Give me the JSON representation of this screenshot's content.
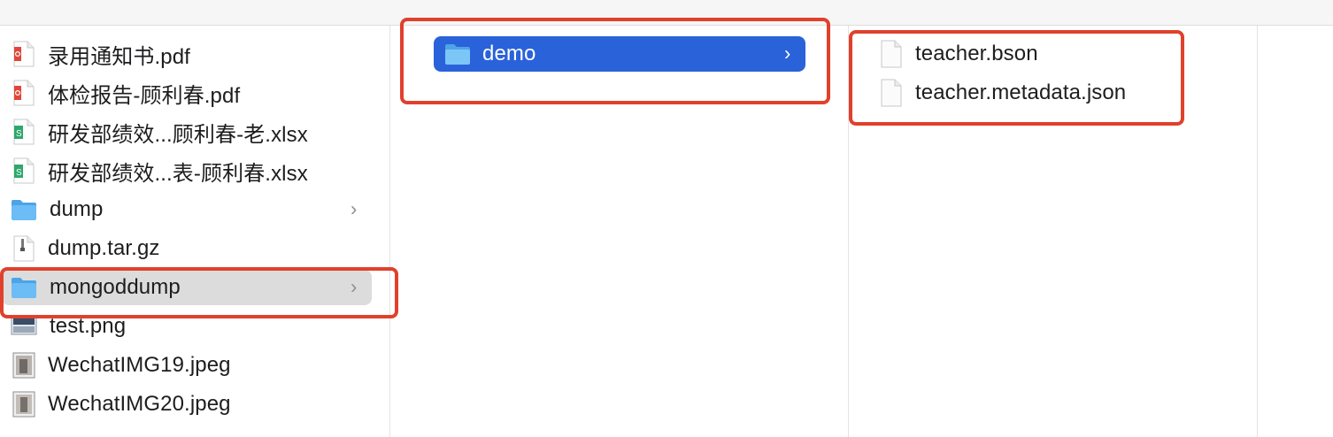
{
  "columns": {
    "left": {
      "items": [
        {
          "name": "录用通知书.pdf",
          "icon": "pdf-file-icon"
        },
        {
          "name": "体检报告-顾利春.pdf",
          "icon": "pdf-file-icon"
        },
        {
          "name": "研发部绩效...顾利春-老.xlsx",
          "icon": "spreadsheet-file-icon"
        },
        {
          "name": "研发部绩效...表-顾利春.xlsx",
          "icon": "spreadsheet-file-icon"
        },
        {
          "name": "dump",
          "icon": "folder-icon"
        },
        {
          "name": "dump.tar.gz",
          "icon": "archive-file-icon"
        },
        {
          "name": "mongoddump",
          "icon": "folder-icon",
          "selected": true
        },
        {
          "name": "test.png",
          "icon": "image-file-icon"
        },
        {
          "name": "WechatIMG19.jpeg",
          "icon": "image-file-icon"
        },
        {
          "name": "WechatIMG20.jpeg",
          "icon": "image-file-icon"
        }
      ]
    },
    "middle": {
      "items": [
        {
          "name": "demo",
          "icon": "folder-icon",
          "selected": true
        }
      ]
    },
    "right": {
      "items": [
        {
          "name": "teacher.bson",
          "icon": "generic-file-icon"
        },
        {
          "name": "teacher.metadata.json",
          "icon": "generic-file-icon"
        }
      ]
    }
  },
  "chevron": "›",
  "colors": {
    "selection_blue": "#2a62d9",
    "selection_gray": "#dcdcdc",
    "annotation_red": "#e0412c",
    "folder_blue": "#5eb2f2"
  }
}
